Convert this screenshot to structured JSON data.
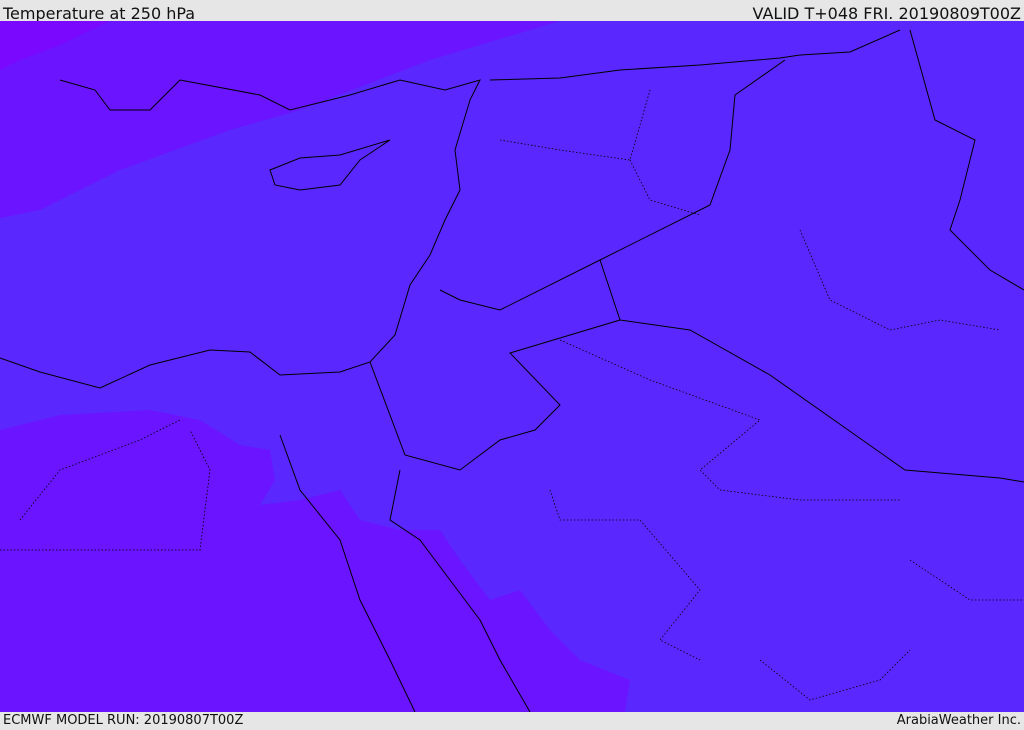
{
  "header": {
    "title": "Temperature at 250 hPa",
    "valid": "VALID T+048 FRI. 20190809T00Z"
  },
  "footer": {
    "model_run": "ECMWF MODEL RUN: 20190807T00Z",
    "credit": "ArabiaWeather Inc."
  },
  "colors": {
    "base": "#5a28ff",
    "warm": "#6a14ff",
    "warmest": "#7a08ff",
    "background": "#e6e6e6"
  }
}
